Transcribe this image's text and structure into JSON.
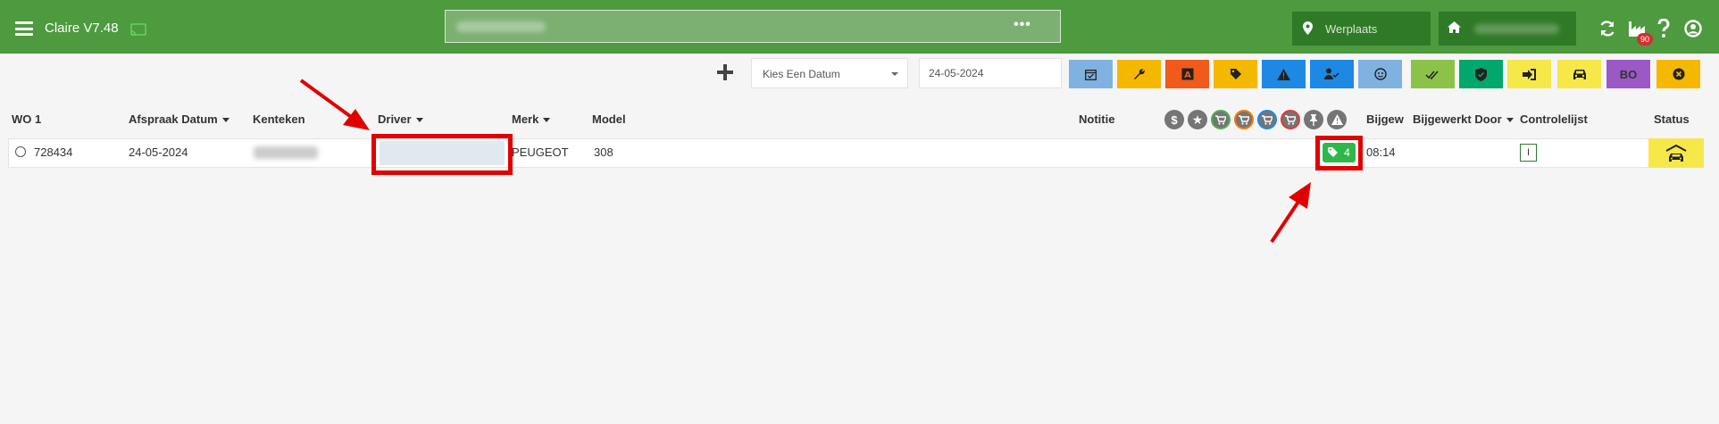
{
  "app": {
    "title": "Claire V7.48"
  },
  "header": {
    "search_more": "•••",
    "location_placeholder": "Werplaats",
    "notification_count": "90"
  },
  "toolbar": {
    "date_select": "Kies Een Datum",
    "date_value": "24-05-2024",
    "filter_buttons": [
      {
        "name": "calendar",
        "color": "#7fb2e0"
      },
      {
        "name": "wrench",
        "color": "#f5b800"
      },
      {
        "name": "letter-a",
        "color": "#f05a1a"
      },
      {
        "name": "tag",
        "color": "#f5b800"
      },
      {
        "name": "warning",
        "color": "#1e88e5"
      },
      {
        "name": "user-check",
        "color": "#1e88e5"
      },
      {
        "name": "face",
        "color": "#7fb2e0"
      },
      {
        "name": "double-check",
        "color": "#8bc34a"
      },
      {
        "name": "shield",
        "color": "#00a86b"
      },
      {
        "name": "exit",
        "color": "#f7e84a"
      },
      {
        "name": "car",
        "color": "#f7e84a"
      },
      {
        "name": "bo",
        "color": "#9b59c6",
        "label": "BO"
      },
      {
        "name": "close-circle",
        "color": "#f5b800"
      }
    ]
  },
  "table": {
    "columns": {
      "wo": "WO  1",
      "afspraak": "Afspraak Datum",
      "kenteken": "Kenteken",
      "driver": "Driver",
      "merk": "Merk",
      "model": "Model",
      "notitie": "Notitie",
      "bijgewerkt": "Bijgewe",
      "bijgewerkt_door": "Bijgewerkt Door",
      "controlelijst": "Controlelijst",
      "status": "Status"
    },
    "header_icons": [
      {
        "name": "dollar",
        "color": "#757575",
        "glyph": "$"
      },
      {
        "name": "star",
        "color": "#757575",
        "glyph": "★"
      },
      {
        "name": "cart-green",
        "color": "#4caf50"
      },
      {
        "name": "cart-orange",
        "color": "#f57c00"
      },
      {
        "name": "cart-blue",
        "color": "#1e88e5"
      },
      {
        "name": "cart-red",
        "color": "#e53935"
      },
      {
        "name": "pin",
        "color": "#757575"
      },
      {
        "name": "warning",
        "color": "#757575"
      }
    ],
    "rows": [
      {
        "wo": "728434",
        "afspraak": "24-05-2024",
        "merk": "PEUGEOT",
        "model": "308",
        "tag_count": "4",
        "bijgewerkt": "08:14",
        "controlelijst": "I"
      }
    ]
  }
}
